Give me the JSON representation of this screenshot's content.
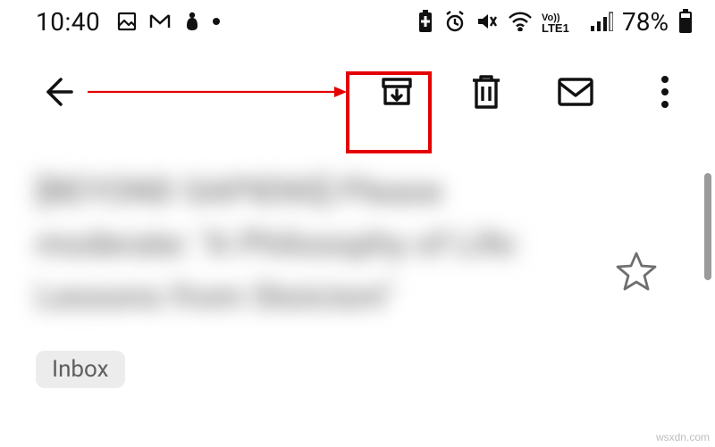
{
  "status_bar": {
    "time": "10:40",
    "battery": "78%",
    "carrier": "LTE1"
  },
  "toolbar": {
    "back": "Back",
    "archive": "Archive",
    "delete": "Delete",
    "mark_unread": "Mark unread",
    "more": "More"
  },
  "email": {
    "subject_blurred": "[BEYOND SAPIENS] Please moderate: \"A Philosophy of Life: Lessons from Stoicism\"",
    "label": "Inbox"
  },
  "annotation": {
    "highlight_target": "archive-button"
  },
  "attribution": "wsxdn.com"
}
